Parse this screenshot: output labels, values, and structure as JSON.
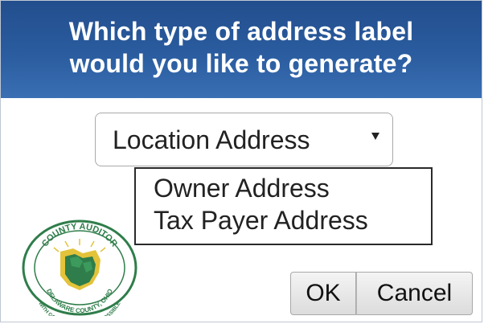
{
  "dialog": {
    "title_line1": "Which type of address label",
    "title_line2": "would you like to generate?"
  },
  "select": {
    "selected": "Location Address",
    "options": [
      "Owner Address",
      "Tax Payer Address"
    ]
  },
  "logo": {
    "top_text": "COUNTY AUDITOR",
    "bottom_text": "DELAWARE COUNTY, OHIO",
    "motto": "WITH GOD ALL THINGS ARE POSSIBLE"
  },
  "buttons": {
    "ok": "OK",
    "cancel": "Cancel"
  },
  "colors": {
    "header_top": "#234e8d",
    "header_bottom": "#3a6fb3",
    "seal_green": "#2f7d4a",
    "seal_yellow": "#e3c33a"
  }
}
